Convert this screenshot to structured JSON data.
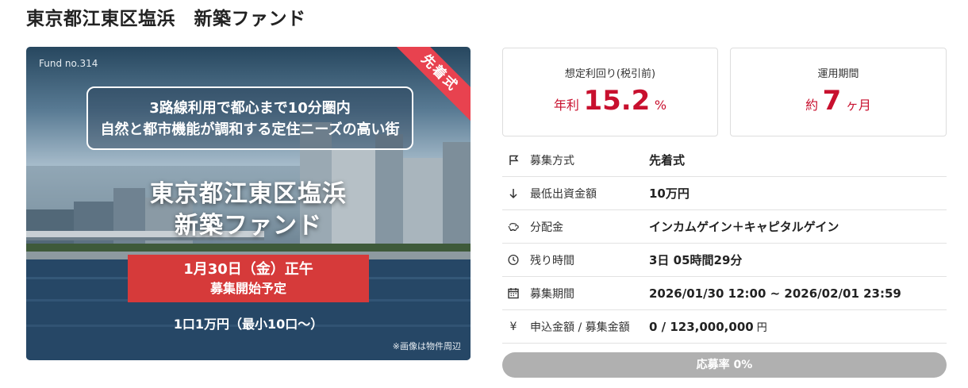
{
  "page": {
    "title": "東京都江東区塩浜　新築ファンド"
  },
  "hero": {
    "fund_no": "Fund no.314",
    "ribbon": "先着式",
    "tagline_line1": "3路線利用で都心まで10分圏内",
    "tagline_line2": "自然と都市機能が調和する定住ニーズの高い街",
    "title_line1": "東京都江東区塩浜",
    "title_line2": "新築ファンド",
    "date_line1": "1月30日（金）正午",
    "date_line2": "募集開始予定",
    "unit_text": "1口1万円（最小10口〜）",
    "photo_note": "※画像は物件周辺"
  },
  "stats": {
    "yield": {
      "label": "想定利回り(税引前)",
      "prefix": "年利",
      "value": "15.2",
      "suffix": "%"
    },
    "period": {
      "label": "運用期間",
      "prefix": "約",
      "value": "7",
      "suffix": "ヶ月"
    }
  },
  "info": [
    {
      "icon": "flag-icon",
      "label": "募集方式",
      "value": "先着式"
    },
    {
      "icon": "arrow-down-icon",
      "label": "最低出資金額",
      "value": "10万円"
    },
    {
      "icon": "piggy-bank-icon",
      "label": "分配金",
      "value": "インカムゲイン＋キャピタルゲイン"
    },
    {
      "icon": "clock-icon",
      "label": "残り時間",
      "value": "3日 05時間29分"
    },
    {
      "icon": "calendar-icon",
      "label": "募集期間",
      "value": "2026/01/30 12:00 ~ 2026/02/01 23:59"
    },
    {
      "icon": "yen-icon",
      "label": "申込金額 / 募集金額",
      "value": "0 / 123,000,000",
      "unit": "円"
    }
  ],
  "progress": {
    "label": "応募率 0%",
    "rate": 0
  },
  "colors": {
    "accent": "#c8102e",
    "ribbon": "#e8424f",
    "banner": "#d63a3a",
    "progress_bg": "#b0b0b0"
  }
}
